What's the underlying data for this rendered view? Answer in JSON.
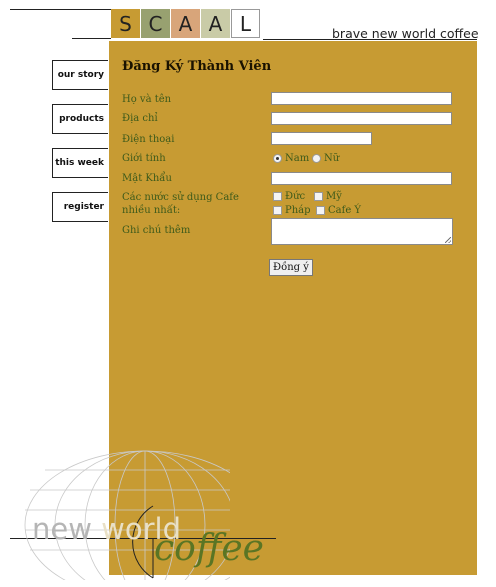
{
  "logo": {
    "letters": [
      "S",
      "C",
      "A",
      "A",
      "L"
    ],
    "colors": [
      "#c79b33",
      "#98a170",
      "#d8a57a",
      "#c9cba7",
      "#ffffff"
    ]
  },
  "tagline": "brave new world coffee",
  "nav": {
    "our_story": "our story",
    "products": "products",
    "this_week": "this week",
    "register": "register"
  },
  "form": {
    "title": "Đăng Ký Thành Viên",
    "labels": {
      "fullname": "Họ và tên",
      "address": "Địa chỉ",
      "phone": "Điện thoại",
      "gender": "Giới tính",
      "password": "Mật Khẩu",
      "countries": "Các nước sử dụng Cafe nhiều nhất:",
      "notes": "Ghi chú thêm"
    },
    "gender_options": {
      "male": "Nam",
      "female": "Nữ",
      "selected": "Nam"
    },
    "country_options": {
      "germany": "Đức",
      "usa": "Mỹ",
      "france": "Pháp",
      "italy": "Cafe Ý"
    },
    "submit_label": "Đồng ý"
  },
  "footer_logo": {
    "word_new": "new",
    "word_world": "world",
    "word_coffee": "coffee"
  }
}
